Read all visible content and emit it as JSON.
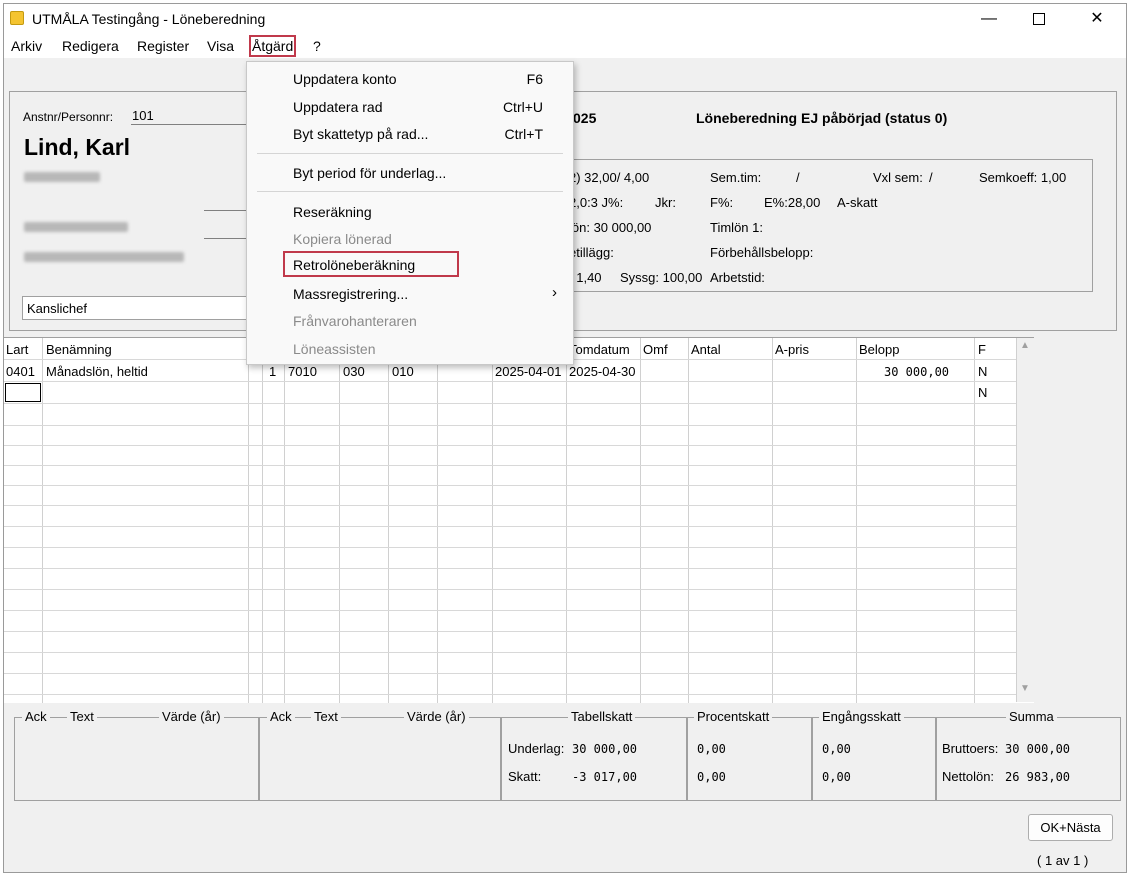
{
  "window": {
    "title": "UTMÅLA Testingång - Löneberedning"
  },
  "menubar": [
    "Arkiv",
    "Redigera",
    "Register",
    "Visa",
    "Åtgärd",
    "?"
  ],
  "header": {
    "anstnr_label": "Anstnr/Personnr:",
    "anstnr_value": "101",
    "name": "Lind, Karl",
    "position": "Kanslichef",
    "period_fragment": "025",
    "status": "Löneberedning EJ påbörjad (status 0)",
    "info": {
      "r1": [
        "2) 32,00/  4,00",
        "Sem.tim:",
        "/",
        "Vxl sem:",
        "/",
        "Semkoeff: 1,00"
      ],
      "r2": [
        "2,0:3  J%:",
        "Jkr:",
        "F%:",
        "E%:28,00",
        "A-skatt"
      ],
      "r3": [
        "lön:  30 000,00",
        "Timlön 1:"
      ],
      "r4": [
        "etillägg:",
        "Förbehållsbelopp:"
      ],
      "r5": [
        ": 1,40",
        "Syssg: 100,00",
        "Arbetstid:"
      ]
    }
  },
  "grid": {
    "columns": [
      "Lart",
      "Benämning",
      "",
      "",
      "",
      "",
      "",
      "",
      "",
      "Tomdatum",
      "Omf",
      "Antal",
      "A-pris",
      "Belopp",
      "F"
    ],
    "row1": {
      "lart": "0401",
      "benamning": "Månadslön, heltid",
      "c1": "1",
      "c2": "7010",
      "c3": "030",
      "c4": "010",
      "fromdatum": "2025-04-01",
      "tomdatum": "2025-04-30",
      "belopp": "30 000,00",
      "f": "N"
    },
    "row2_f": "N"
  },
  "summary": {
    "ack1": "Ack",
    "text1": "Text",
    "varde1": "Värde (år)",
    "ack2": "Ack",
    "text2": "Text",
    "varde2": "Värde (år)",
    "tabellskatt": "Tabellskatt",
    "procentskatt": "Procentskatt",
    "engangsskatt": "Engångsskatt",
    "summa": "Summa",
    "underlag_label": "Underlag:",
    "skatt_label": "Skatt:",
    "tab_underlag": "30 000,00",
    "tab_skatt": "-3 017,00",
    "proc_underlag": "0,00",
    "proc_skatt": "0,00",
    "eng_underlag": "0,00",
    "eng_skatt": "0,00",
    "bruttoers_label": "Bruttoers:",
    "bruttoers": "30 000,00",
    "nettolon_label": "Nettolön:",
    "nettolon": "26 983,00"
  },
  "buttons": {
    "ok_next": "OK+Nästa"
  },
  "pager": "( 1 av 1 )",
  "dropdown_menu": {
    "items": [
      {
        "label": "Uppdatera konto",
        "shortcut": "F6",
        "enabled": true
      },
      {
        "label": "Uppdatera rad",
        "shortcut": "Ctrl+U",
        "enabled": true
      },
      {
        "label": "Byt skattetyp på rad...",
        "shortcut": "Ctrl+T",
        "enabled": true
      },
      {
        "label": "Byt period för underlag...",
        "shortcut": "",
        "enabled": true
      },
      {
        "label": "Reseräkning",
        "shortcut": "",
        "enabled": true
      },
      {
        "label": "Kopiera lönerad",
        "shortcut": "",
        "enabled": false
      },
      {
        "label": "Retrolöneberäkning",
        "shortcut": "",
        "enabled": true
      },
      {
        "label": "Massregistrering...",
        "shortcut": "",
        "enabled": true
      },
      {
        "label": "Frånvarohanteraren",
        "shortcut": "",
        "enabled": false
      },
      {
        "label": "Löneassisten",
        "shortcut": "",
        "enabled": false
      }
    ]
  },
  "colors": {
    "highlight": "#c0394b",
    "disabled_text": "#8a8a8a"
  }
}
